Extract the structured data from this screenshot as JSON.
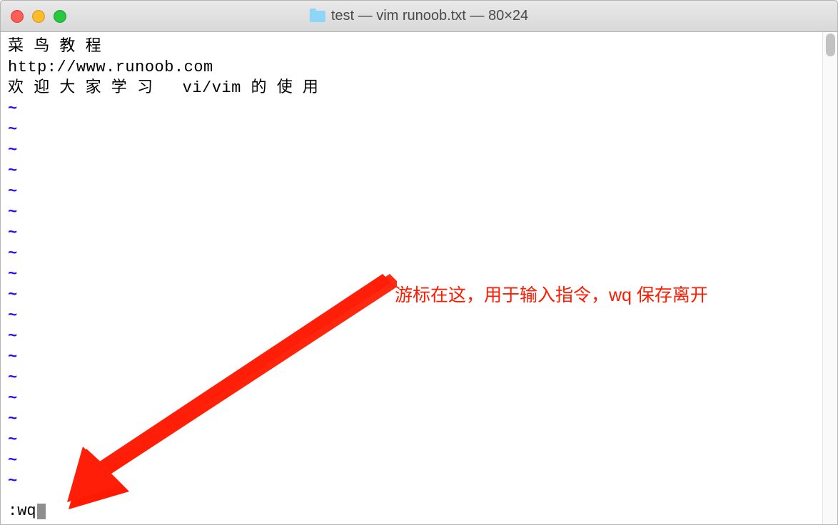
{
  "window": {
    "title": "test — vim runoob.txt — 80×24"
  },
  "editor": {
    "lines": [
      "菜 鸟 教 程",
      "http://www.runoob.com",
      "欢 迎 大 家 学 习   vi/vim 的 使 用"
    ],
    "tilde_count": 19,
    "command": ":wq"
  },
  "annotation": {
    "text": "游标在这，用于输入指令，wq 保存离开"
  }
}
